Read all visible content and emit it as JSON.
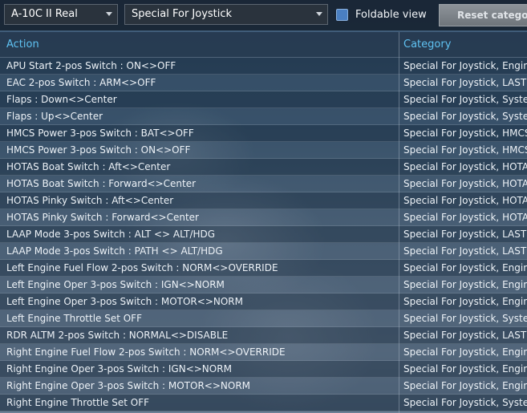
{
  "toolbar": {
    "aircraft_select": "A-10C II Real",
    "category_select": "Special For Joystick",
    "foldable_label": "Foldable view",
    "foldable_checked": true,
    "reset_label": "Reset category"
  },
  "table": {
    "headers": {
      "action": "Action",
      "category": "Category"
    },
    "rows": [
      {
        "action": "APU Start 2-pos Switch : ON<>OFF",
        "category": "Special For Joystick, Engin"
      },
      {
        "action": "EAC 2-pos Switch : ARM<>OFF",
        "category": "Special For Joystick, LASTI"
      },
      {
        "action": "Flaps : Down<>Center",
        "category": "Special For Joystick, Syste"
      },
      {
        "action": "Flaps : Up<>Center",
        "category": "Special For Joystick, Syste"
      },
      {
        "action": "HMCS Power 3-pos Switch : BAT<>OFF",
        "category": "Special For Joystick, HMCS"
      },
      {
        "action": "HMCS Power 3-pos Switch : ON<>OFF",
        "category": "Special For Joystick, HMCS"
      },
      {
        "action": "HOTAS Boat Switch : Aft<>Center",
        "category": "Special For Joystick, HOTA"
      },
      {
        "action": "HOTAS Boat Switch : Forward<>Center",
        "category": "Special For Joystick, HOTA"
      },
      {
        "action": "HOTAS Pinky Switch : Aft<>Center",
        "category": "Special For Joystick, HOTA"
      },
      {
        "action": "HOTAS Pinky Switch : Forward<>Center",
        "category": "Special For Joystick, HOTA"
      },
      {
        "action": "LAAP Mode 3-pos Switch : ALT <> ALT/HDG",
        "category": "Special For Joystick, LASTI"
      },
      {
        "action": "LAAP Mode 3-pos Switch : PATH <> ALT/HDG",
        "category": "Special For Joystick, LASTI"
      },
      {
        "action": "Left Engine Fuel Flow 2-pos Switch : NORM<>OVERRIDE",
        "category": "Special For Joystick, Engin"
      },
      {
        "action": "Left Engine Oper 3-pos Switch : IGN<>NORM",
        "category": "Special For Joystick, Engin"
      },
      {
        "action": "Left Engine Oper 3-pos Switch : MOTOR<>NORM",
        "category": "Special For Joystick, Engin"
      },
      {
        "action": "Left Engine Throttle Set OFF",
        "category": "Special For Joystick, Syste"
      },
      {
        "action": "RDR ALTM 2-pos Switch : NORMAL<>DISABLE",
        "category": "Special For Joystick, LASTI"
      },
      {
        "action": "Right Engine Fuel Flow 2-pos Switch : NORM<>OVERRIDE",
        "category": "Special For Joystick, Engin"
      },
      {
        "action": "Right Engine Oper 3-pos Switch : IGN<>NORM",
        "category": "Special For Joystick, Engin"
      },
      {
        "action": "Right Engine Oper 3-pos Switch : MOTOR<>NORM",
        "category": "Special For Joystick, Engin"
      },
      {
        "action": "Right Engine Throttle Set OFF",
        "category": "Special For Joystick, Syste"
      }
    ]
  }
}
